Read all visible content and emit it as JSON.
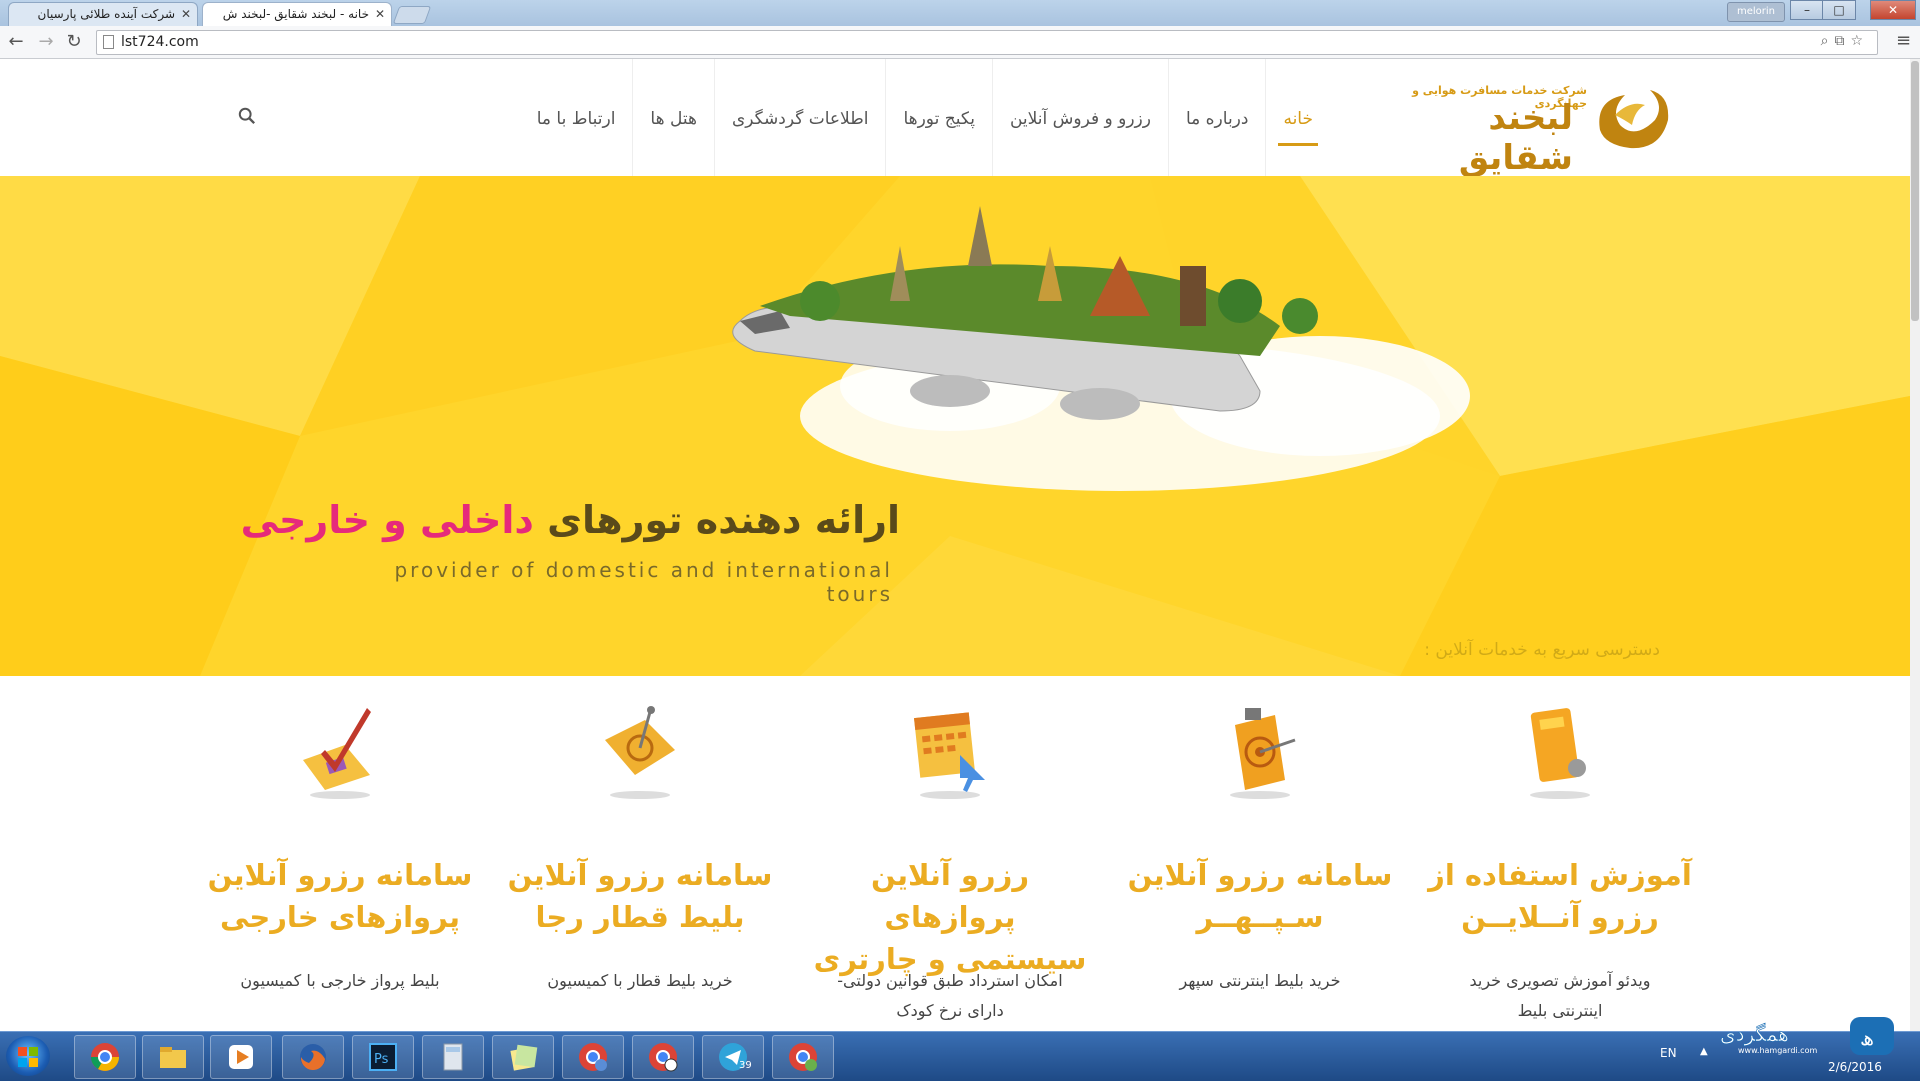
{
  "browser": {
    "tabs": [
      {
        "title": "شرکت آینده طلائی پارسیان"
      },
      {
        "title": "خانه - لبخند شقایق -لبخند ش"
      }
    ],
    "user": "melorin",
    "url": "lst724.com"
  },
  "site": {
    "logo_subtitle": "شرکت خدمات مسافرت هوایی و جهانگردی",
    "logo_name": "لبخند شقایق",
    "nav": [
      {
        "label": "خانه",
        "active": true
      },
      {
        "label": "درباره ما"
      },
      {
        "label": "رزرو و فروش آنلاین"
      },
      {
        "label": "پکیج تورها"
      },
      {
        "label": "اطلاعات گردشگری"
      },
      {
        "label": "هتل ها"
      },
      {
        "label": "ارتباط با ما"
      }
    ]
  },
  "hero": {
    "title_start": "ارائه دهنده تورهای",
    "title_highlight": "داخلی و خارجی",
    "subtitle": "provider of domestic and international tours",
    "quick_access": "دسترسی سریع به خدمات آنلاین :"
  },
  "services": [
    {
      "title_line1": "آموزش استفاده از",
      "title_line2": "رزرو آنــلایــن",
      "desc_line1": "ویدئو آموزش تصویری خرید",
      "desc_line2": "اینترنتی بلیط",
      "icon": "tutorial-icon"
    },
    {
      "title_line1": "سامانه رزرو آنلاین",
      "title_line2": "سـپــهــر",
      "desc_line1": "خرید بلیط اینترنتی سپهر",
      "desc_line2": "",
      "icon": "target-icon"
    },
    {
      "title_line1": "رزرو آنلاین پروازهای",
      "title_line2": "سیستمی و چارتری",
      "desc_line1": "امکان استرداد طبق قوانین دولتی-",
      "desc_line2": "دارای نرخ کودک",
      "icon": "calendar-icon"
    },
    {
      "title_line1": "سامانه رزرو آنلاین",
      "title_line2": "بلیط قطار رجا",
      "desc_line1": "خرید بلیط قطار با کمیسیون",
      "desc_line2": "",
      "icon": "map-icon"
    },
    {
      "title_line1": "سامانه رزرو آنلاین",
      "title_line2": "پروازهای خارجی",
      "desc_line1": "بلیط پرواز خارجی با کمیسیون",
      "desc_line2": "",
      "icon": "ticket-check-icon"
    }
  ],
  "taskbar": {
    "apps": [
      "chrome-icon",
      "explorer-icon",
      "media-player-icon",
      "firefox-icon",
      "photoshop-icon",
      "calculator-icon",
      "sticky-notes-icon",
      "chrome-user-icon",
      "chrome-ball-icon",
      "telegram-icon",
      "chrome-profile-icon"
    ],
    "telegram_badge": "39",
    "language": "EN",
    "date": "2/6/2016"
  },
  "colors": {
    "brand": "#d79b16",
    "hero_bg": "#ffd52b",
    "highlight": "#e62a7b",
    "service_title": "#ebac22"
  }
}
